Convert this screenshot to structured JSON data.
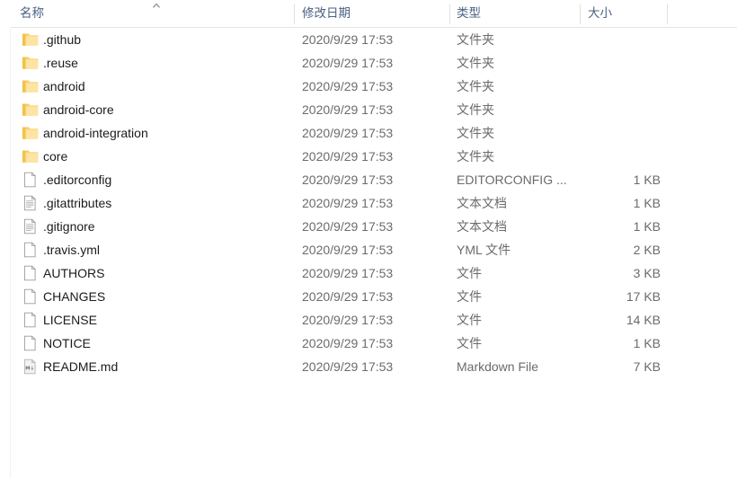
{
  "window": {
    "app": "Windows File Explorer",
    "view": "details-list"
  },
  "columns": {
    "name": "名称",
    "date_modified": "修改日期",
    "type": "类型",
    "size": "大小",
    "sort": {
      "column": "名称",
      "direction": "ascending",
      "caret": "chevron-up-icon"
    }
  },
  "items": [
    {
      "icon": "folder-icon",
      "name": ".github",
      "date": "2020/9/29 17:53",
      "type": "文件夹",
      "size": ""
    },
    {
      "icon": "folder-icon",
      "name": ".reuse",
      "date": "2020/9/29 17:53",
      "type": "文件夹",
      "size": ""
    },
    {
      "icon": "folder-icon",
      "name": "android",
      "date": "2020/9/29 17:53",
      "type": "文件夹",
      "size": ""
    },
    {
      "icon": "folder-icon",
      "name": "android-core",
      "date": "2020/9/29 17:53",
      "type": "文件夹",
      "size": ""
    },
    {
      "icon": "folder-icon",
      "name": "android-integration",
      "date": "2020/9/29 17:53",
      "type": "文件夹",
      "size": ""
    },
    {
      "icon": "folder-icon",
      "name": "core",
      "date": "2020/9/29 17:53",
      "type": "文件夹",
      "size": ""
    },
    {
      "icon": "blank-file-icon",
      "name": ".editorconfig",
      "date": "2020/9/29 17:53",
      "type": "EDITORCONFIG ...",
      "size": "1 KB"
    },
    {
      "icon": "text-document-icon",
      "name": ".gitattributes",
      "date": "2020/9/29 17:53",
      "type": "文本文档",
      "size": "1 KB"
    },
    {
      "icon": "text-document-icon",
      "name": ".gitignore",
      "date": "2020/9/29 17:53",
      "type": "文本文档",
      "size": "1 KB"
    },
    {
      "icon": "blank-file-icon",
      "name": ".travis.yml",
      "date": "2020/9/29 17:53",
      "type": "YML 文件",
      "size": "2 KB"
    },
    {
      "icon": "blank-file-icon",
      "name": "AUTHORS",
      "date": "2020/9/29 17:53",
      "type": "文件",
      "size": "3 KB"
    },
    {
      "icon": "blank-file-icon",
      "name": "CHANGES",
      "date": "2020/9/29 17:53",
      "type": "文件",
      "size": "17 KB"
    },
    {
      "icon": "blank-file-icon",
      "name": "LICENSE",
      "date": "2020/9/29 17:53",
      "type": "文件",
      "size": "14 KB"
    },
    {
      "icon": "blank-file-icon",
      "name": "NOTICE",
      "date": "2020/9/29 17:53",
      "type": "文件",
      "size": "1 KB"
    },
    {
      "icon": "markdown-file-icon",
      "name": "README.md",
      "date": "2020/9/29 17:53",
      "type": "Markdown File",
      "size": "7 KB"
    }
  ],
  "colors": {
    "folder": "#FBD579",
    "folder_shade": "#F2C24A",
    "header_text": "#4a6181",
    "row_text": "#1b1b1b",
    "meta_text": "#6b6b6b",
    "divider": "#e2e2e2",
    "background": "#ffffff"
  }
}
